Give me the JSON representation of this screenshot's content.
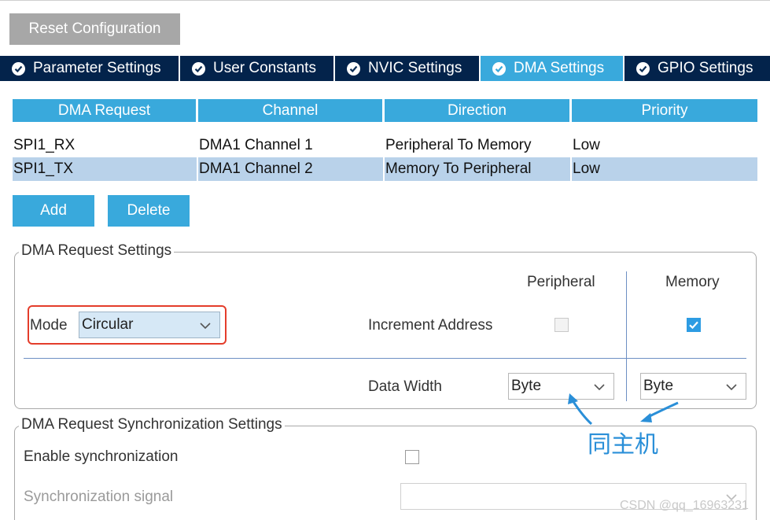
{
  "toolbar": {
    "reset_label": "Reset Configuration"
  },
  "tabs": [
    {
      "label": "Parameter Settings"
    },
    {
      "label": "User Constants"
    },
    {
      "label": "NVIC Settings"
    },
    {
      "label": "DMA Settings",
      "active": true
    },
    {
      "label": "GPIO Settings"
    }
  ],
  "table": {
    "headers": [
      "DMA Request",
      "Channel",
      "Direction",
      "Priority"
    ],
    "rows": [
      {
        "request": "SPI1_RX",
        "channel": "DMA1 Channel 1",
        "direction": "Peripheral To Memory",
        "priority": "Low"
      },
      {
        "request": "SPI1_TX",
        "channel": "DMA1 Channel 2",
        "direction": "Memory To Peripheral",
        "priority": "Low"
      }
    ]
  },
  "actions": {
    "add_label": "Add",
    "delete_label": "Delete"
  },
  "request_settings": {
    "title": "DMA Request Settings",
    "peripheral_header": "Peripheral",
    "memory_header": "Memory",
    "mode_label": "Mode",
    "mode_value": "Circular",
    "increment_label": "Increment Address",
    "peripheral_increment": false,
    "memory_increment": true,
    "data_width_label": "Data Width",
    "peripheral_width": "Byte",
    "memory_width": "Byte"
  },
  "sync_settings": {
    "title": "DMA Request Synchronization Settings",
    "enable_label": "Enable synchronization",
    "enable_checked": false,
    "signal_label": "Synchronization signal",
    "signal_value": ""
  },
  "annotation": {
    "text": "同主机"
  },
  "watermark": {
    "text": "CSDN @qq_16963231"
  },
  "colors": {
    "tab_bar": "#03234b",
    "accent": "#39a9dc",
    "selected_row": "#b9d2ea",
    "highlight_box": "#e43d2b",
    "annotation": "#2a8fd8"
  }
}
